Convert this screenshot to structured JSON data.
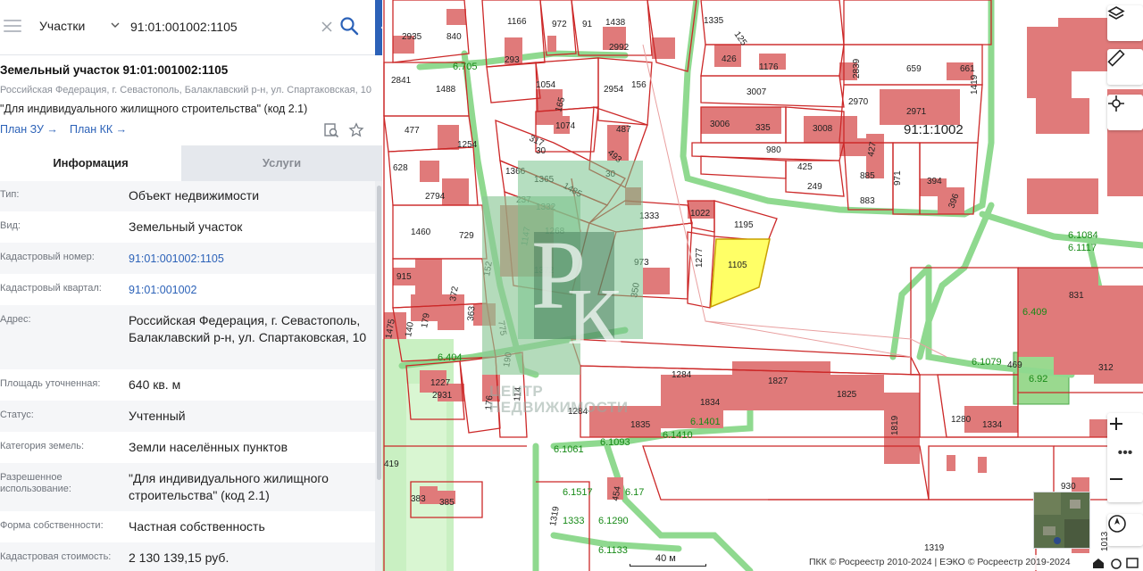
{
  "search": {
    "type_label": "Участки",
    "value": "91:01:001002:1105"
  },
  "card": {
    "title": "Земельный участок 91:01:001002:1105",
    "address_short": "Российская Федерация, г. Севастополь, Балаклавский р-н, ул. Спартаковская, 10",
    "permitted_use_short": "\"Для индивидуального жилищного строительства\" (код 2.1)",
    "plan_zu": "План ЗУ →",
    "plan_kk": "План КК →"
  },
  "tabs": {
    "info": "Информация",
    "services": "Услуги"
  },
  "rows": [
    {
      "key": "Тип:",
      "value": "Объект недвижимости"
    },
    {
      "key": "Вид:",
      "value": "Земельный участок"
    },
    {
      "key": "Кадастровый номер:",
      "value": "91:01:001002:1105"
    },
    {
      "key": "Кадастровый квартал:",
      "value": "91:01:001002"
    },
    {
      "key": "Адрес:",
      "value": "Российская Федерация, г. Севастополь, Балаклавский р-н, ул. Спартаковская, 10"
    },
    {
      "key": "Площадь уточненная:",
      "value": "640 кв. м"
    },
    {
      "key": "Статус:",
      "value": "Учтенный"
    },
    {
      "key": "Категория земель:",
      "value": "Земли населённых пунктов"
    },
    {
      "key": "Разрешенное использование:",
      "value": "\"Для индивидуального жилищного строительства\" (код 2.1)"
    },
    {
      "key": "Форма собственности:",
      "value": "Частная собственность"
    },
    {
      "key": "Кадастровая стоимость:",
      "value": "2 130 139,15 руб."
    }
  ],
  "map": {
    "quarter_label": "91:1:1002",
    "selected_parcel": "1105",
    "scale_label": "40 м",
    "copyright": "ПКК © Росреестр 2010-2024 | ЕЭКО © Росреестр 2019-2024",
    "watermark_letters": "РК",
    "watermark_text_1": "ЦЕНТР",
    "watermark_text_2": "НЕДВИЖИМОСТИ",
    "parcel_labels": [
      "2935",
      "840",
      "1166",
      "972",
      "159",
      "91",
      "1438",
      "2992",
      "1335",
      "125",
      "293",
      "1054",
      "1488",
      "2841",
      "6.705",
      "2954",
      "156",
      "426",
      "1176",
      "2839",
      "659",
      "661",
      "3007",
      "2970",
      "2971",
      "1254",
      "477",
      "1074",
      "487",
      "1365",
      "165",
      "3006",
      "335",
      "3008",
      "980",
      "425",
      "249",
      "91:1:1002",
      "628",
      "1366",
      "30",
      "493",
      "427",
      "885",
      "971",
      "394",
      "396",
      "883",
      "2794",
      "237",
      "1332",
      "1485",
      "1333",
      "1022",
      "1195",
      "1460",
      "729",
      "1268",
      "1147",
      "1277",
      "1105",
      "973",
      "6.1084",
      "6.1117",
      "915",
      "372",
      "152",
      "1372",
      "350",
      "831",
      "775",
      "1475",
      "140",
      "179",
      "363",
      "6.409",
      "6.404",
      "190",
      "1284",
      "1827",
      "1825",
      "469",
      "6.1079",
      "6.92",
      "312",
      "1227",
      "2931",
      "176",
      "114",
      "1834",
      "1819",
      "1280",
      "1334",
      "1284",
      "1835",
      "6.1401",
      "6.1410",
      "6.1061",
      "6.1093",
      "419",
      "383",
      "385",
      "930",
      "6.1517",
      "6.17",
      "6.1290",
      "1319",
      "1333",
      "6.1133",
      "1319",
      "1013"
    ],
    "zone_labels": [
      "6.705",
      "6.1084",
      "6.1117",
      "6.409",
      "6.404",
      "6.1079",
      "6.92",
      "6.1401",
      "6.1410",
      "6.1061",
      "6.1093",
      "6.1517",
      "6.17",
      "6.1290",
      "6.1133"
    ]
  },
  "colors": {
    "accent": "#2c62b8",
    "parcel_border": "#cc2828",
    "building": "#e07a7a",
    "zone_green": "#8fd98f",
    "selected": "#ffff66"
  }
}
